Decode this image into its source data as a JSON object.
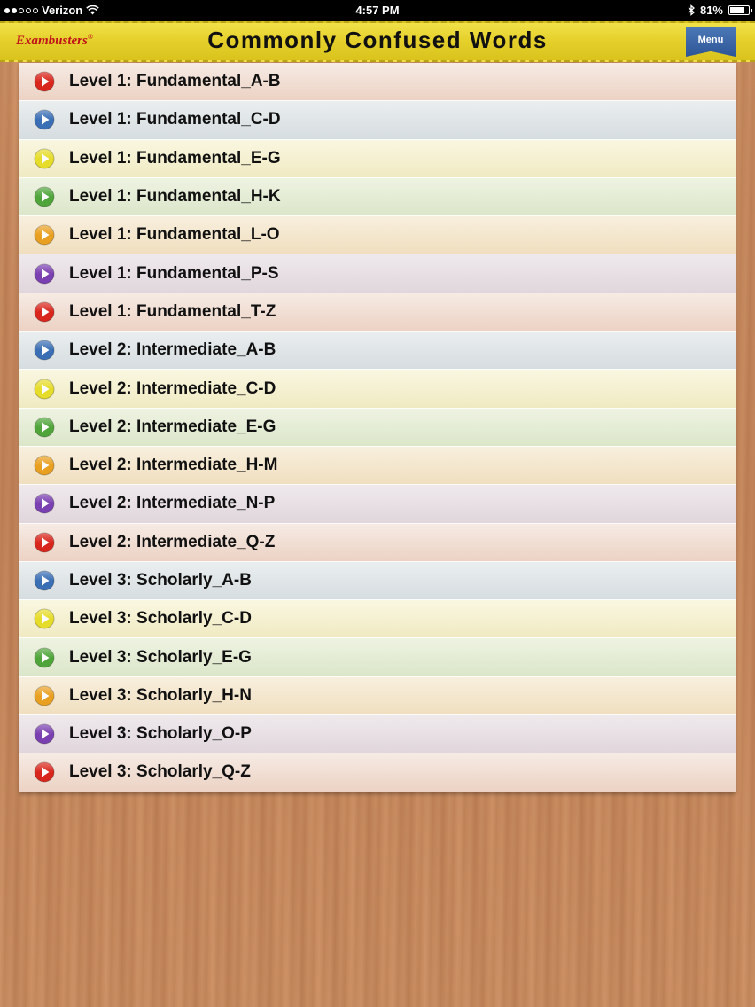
{
  "status_bar": {
    "carrier": "Verizon",
    "time": "4:57 PM",
    "battery": "81%",
    "battery_level": 0.81,
    "signal_bars": 2,
    "wifi_icon": "wifi-icon",
    "bluetooth_icon": "bluetooth-icon"
  },
  "header": {
    "brand": "Exambusters",
    "brand_mark": "®",
    "title": "Commonly Confused Words",
    "menu_label": "Menu",
    "colors": {
      "banner": "#e6d12c",
      "brand": "#c0121a",
      "menu": "#2d5596"
    }
  },
  "icon_colors": {
    "red": "#d9261c",
    "blue": "#3a6fb5",
    "yellow": "#e6dc2a",
    "green": "#4fa53a",
    "orange": "#e9a021",
    "purple": "#7a3fb0"
  },
  "levels": [
    {
      "label": "Level 1: Fundamental_A-B",
      "color": "red"
    },
    {
      "label": "Level 1: Fundamental_C-D",
      "color": "blue"
    },
    {
      "label": "Level 1: Fundamental_E-G",
      "color": "yellow"
    },
    {
      "label": "Level 1: Fundamental_H-K",
      "color": "green"
    },
    {
      "label": "Level 1: Fundamental_L-O",
      "color": "orange"
    },
    {
      "label": "Level 1: Fundamental_P-S",
      "color": "purple"
    },
    {
      "label": "Level 1: Fundamental_T-Z",
      "color": "red"
    },
    {
      "label": "Level 2: Intermediate_A-B",
      "color": "blue"
    },
    {
      "label": "Level 2: Intermediate_C-D",
      "color": "yellow"
    },
    {
      "label": "Level 2: Intermediate_E-G",
      "color": "green"
    },
    {
      "label": "Level 2: Intermediate_H-M",
      "color": "orange"
    },
    {
      "label": "Level 2: Intermediate_N-P",
      "color": "purple"
    },
    {
      "label": "Level 2: Intermediate_Q-Z",
      "color": "red"
    },
    {
      "label": "Level 3: Scholarly_A-B",
      "color": "blue"
    },
    {
      "label": "Level 3: Scholarly_C-D",
      "color": "yellow"
    },
    {
      "label": "Level 3: Scholarly_E-G",
      "color": "green"
    },
    {
      "label": "Level 3: Scholarly_H-N",
      "color": "orange"
    },
    {
      "label": "Level 3: Scholarly_O-P",
      "color": "purple"
    },
    {
      "label": "Level 3: Scholarly_Q-Z",
      "color": "red"
    }
  ]
}
